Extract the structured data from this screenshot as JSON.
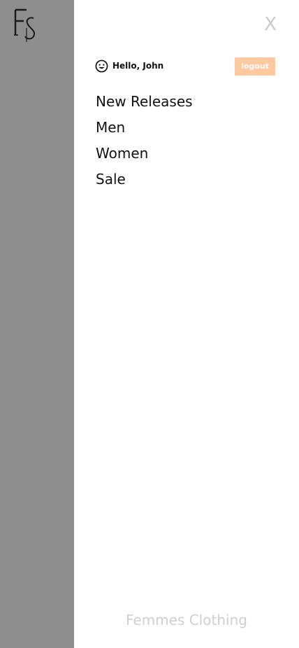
{
  "logo": {
    "text": "FS",
    "icon": "fs-monogram-logo"
  },
  "drawer": {
    "close_label": "X",
    "greeting": "Hello, John",
    "greeting_icon": "smiley-icon",
    "logout_label": "logout",
    "nav_items": [
      {
        "label": "New Releases"
      },
      {
        "label": "Men"
      },
      {
        "label": "Women"
      },
      {
        "label": "Sale"
      }
    ],
    "footer_brand": "Femmes Clothing"
  },
  "colors": {
    "overlay": "#8e8e8e",
    "drawer_bg": "#ffffff",
    "logout_bg": "#ffc89e",
    "muted": "#c9c9c9"
  }
}
